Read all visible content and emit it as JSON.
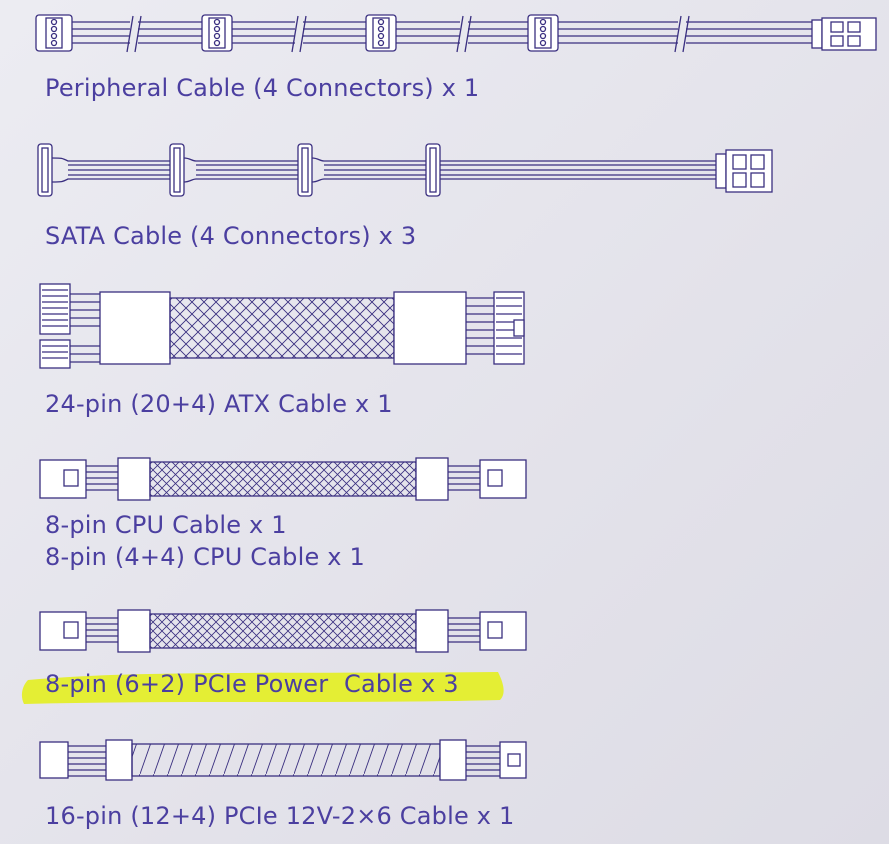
{
  "colors": {
    "ink": "#3a2f80",
    "label": "#4b3fa0",
    "highlight": "#e4ee2a"
  },
  "cables": [
    {
      "label": "Peripheral Cable (4 Connectors) x 1"
    },
    {
      "label": "SATA Cable (4 Connectors) x 3"
    },
    {
      "label": "24-pin (20+4) ATX Cable x 1"
    },
    {
      "label": "8-pin CPU Cable x 1"
    },
    {
      "label": "8-pin (4+4) CPU Cable x 1"
    },
    {
      "label": "8-pin (6+2) PCIe Power  Cable x 3",
      "highlighted": true
    },
    {
      "label": "16-pin (12+4) PCIe 12V-2×6 Cable x 1"
    }
  ]
}
